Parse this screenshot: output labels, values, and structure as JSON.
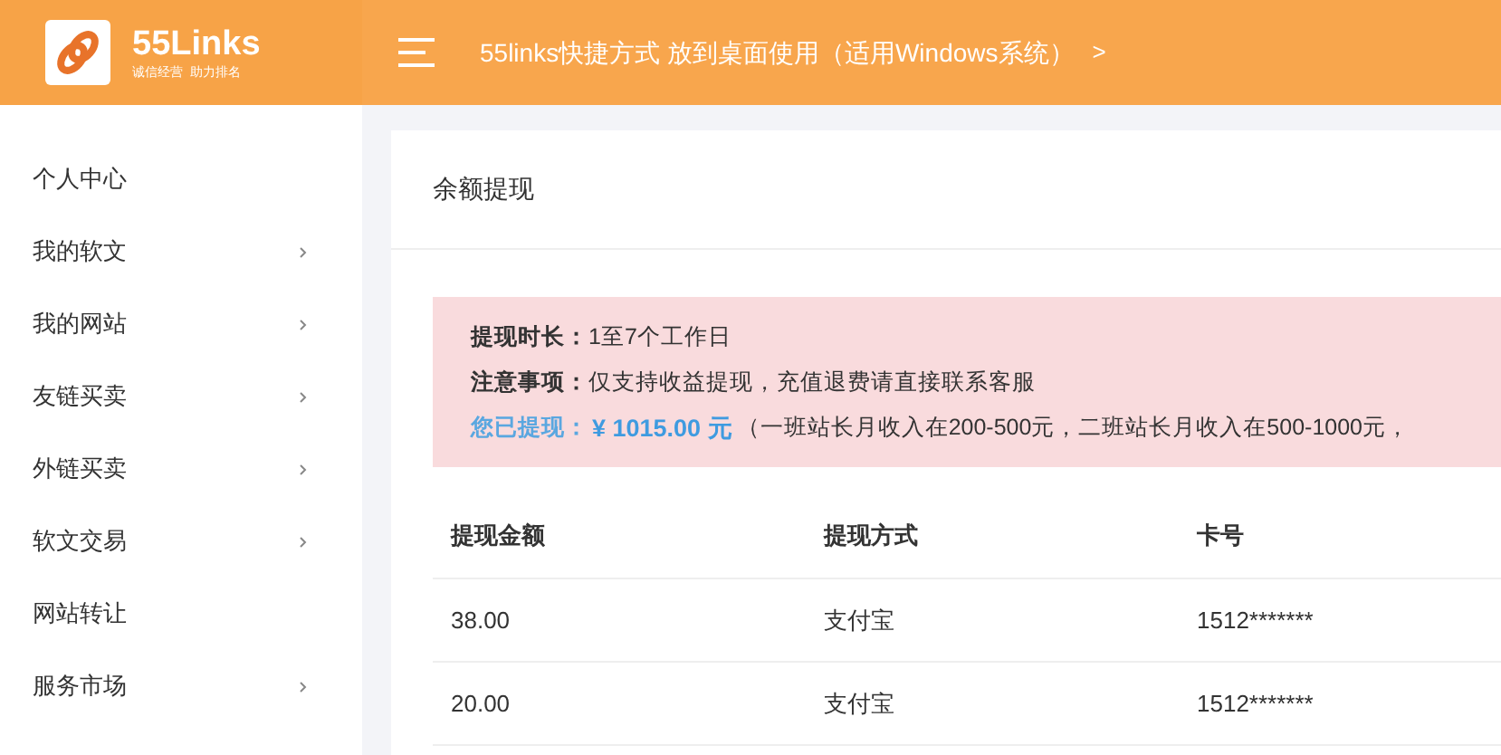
{
  "header": {
    "logo": {
      "name": "55Links",
      "tagline": "诚信经营  助力排名"
    },
    "breadcrumb": "55links快捷方式 放到桌面使用（适用Windows系统）",
    "breadcrumb_separator": ">"
  },
  "sidebar": {
    "items": [
      {
        "label": "个人中心",
        "has_submenu": false
      },
      {
        "label": "我的软文",
        "has_submenu": true
      },
      {
        "label": "我的网站",
        "has_submenu": true
      },
      {
        "label": "友链买卖",
        "has_submenu": true
      },
      {
        "label": "外链买卖",
        "has_submenu": true
      },
      {
        "label": "软文交易",
        "has_submenu": true
      },
      {
        "label": "网站转让",
        "has_submenu": false
      },
      {
        "label": "服务市场",
        "has_submenu": true
      }
    ]
  },
  "card": {
    "title": "余额提现",
    "notice": {
      "duration_label": "提现时长：",
      "duration": "1至7个工作日",
      "note_label": "注意事项：",
      "note": "仅支持收益提现，充值退费请直接联系客服",
      "withdrawn_label": "您已提现：",
      "withdrawn_amount": "¥ 1015.00 元",
      "withdrawn_remark": "（一班站长月收入在200-500元，二班站长月收入在500-1000元，"
    },
    "table": {
      "columns": [
        "提现金额",
        "提现方式",
        "卡号"
      ],
      "rows": [
        [
          "38.00",
          "支付宝",
          "1512*******"
        ],
        [
          "20.00",
          "支付宝",
          "1512*******"
        ]
      ]
    }
  }
}
